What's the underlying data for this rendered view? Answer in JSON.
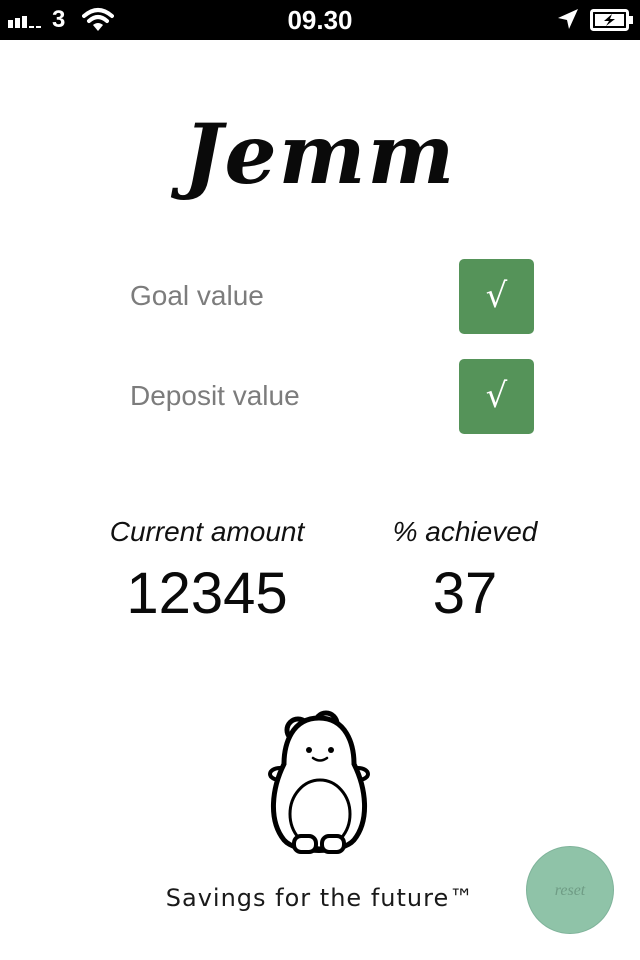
{
  "status_bar": {
    "carrier": "3",
    "time": "09.30",
    "icons": [
      "signal-icon",
      "wifi-icon",
      "location-icon",
      "battery-icon"
    ]
  },
  "app": {
    "title": "Jemm",
    "tagline": "Savings for the future™"
  },
  "values": {
    "goal_label": "Goal value",
    "goal_button": "√",
    "deposit_label": "Deposit value",
    "deposit_button": "√"
  },
  "stats": {
    "current_label": "Current amount",
    "current_value": "12345",
    "achieved_label": "% achieved",
    "achieved_value": "37"
  },
  "reset_label": "reset",
  "colors": {
    "check_green": "#559359",
    "reset_green": "#8fc3a8",
    "label_gray": "#7c7c7c"
  }
}
